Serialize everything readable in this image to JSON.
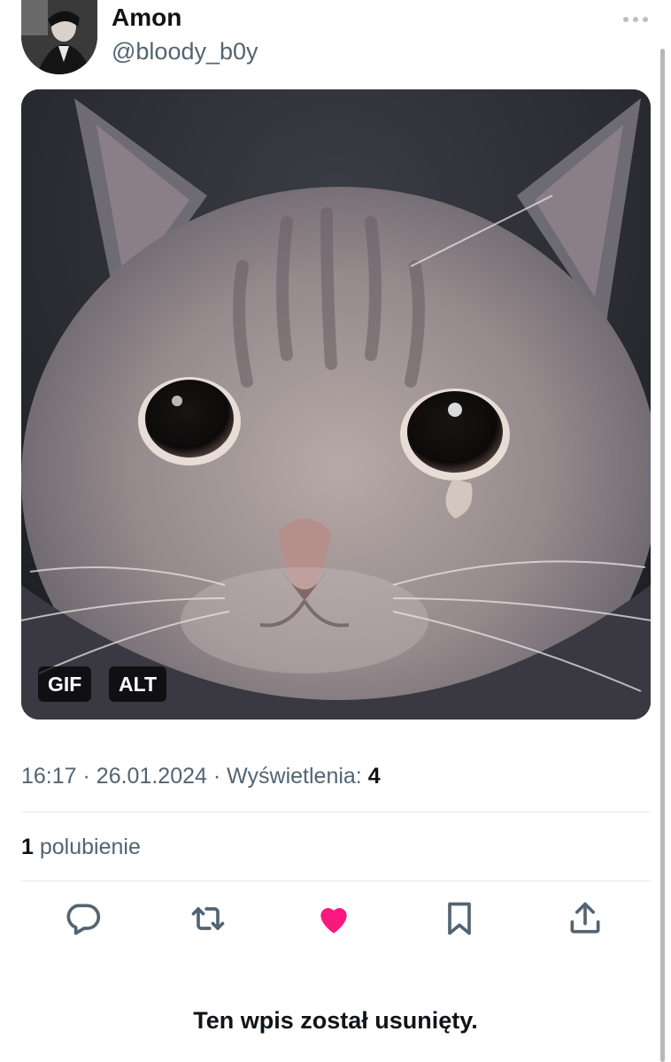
{
  "tweet": {
    "display_name": "Amon",
    "handle": "@bloody_b0y",
    "media": {
      "description": "crying grey cat GIF",
      "badges": {
        "gif": "GIF",
        "alt": "ALT"
      }
    },
    "time": "16:17",
    "separator": "·",
    "date": "26.01.2024",
    "views_label": "Wyświetlenia:",
    "views_count": "4",
    "likes_count": "1",
    "likes_label": "polubienie",
    "liked": true,
    "like_color": "#f91880"
  },
  "actions": {
    "icons": [
      "reply-icon",
      "retweet-icon",
      "like-icon",
      "bookmark-icon",
      "share-icon"
    ]
  },
  "footer": {
    "deleted_message": "Ten wpis został usunięty."
  },
  "colors": {
    "text_primary": "#0f1419",
    "text_secondary": "#536471",
    "divider": "#e6e9ec"
  }
}
